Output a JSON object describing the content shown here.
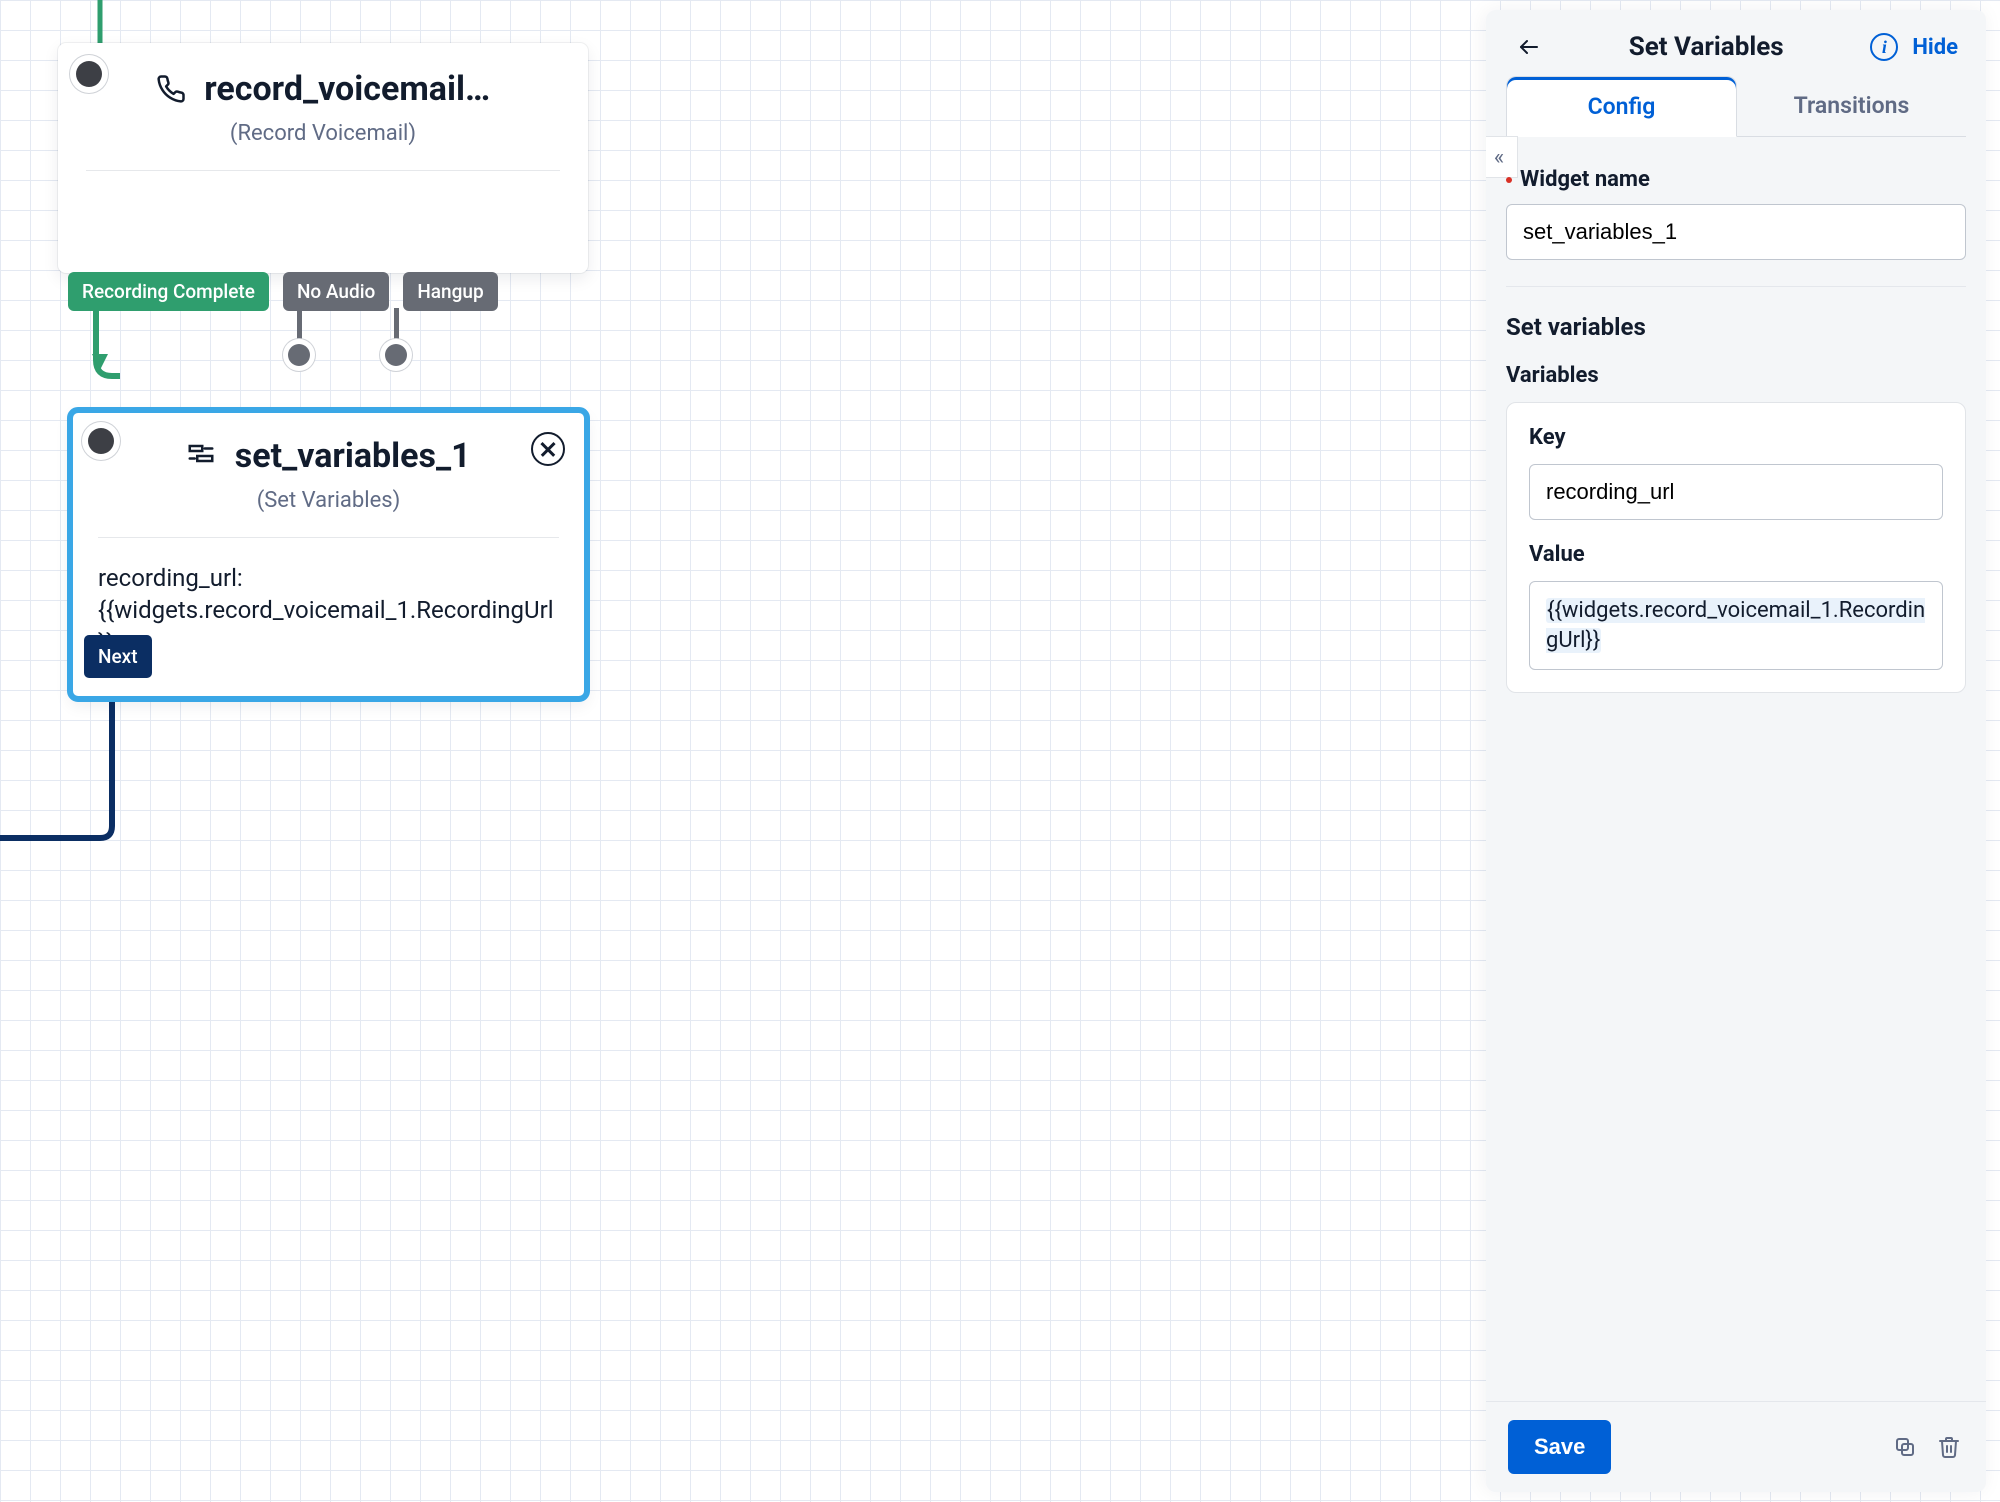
{
  "node1": {
    "title": "record_voicemail…",
    "subtitle": "(Record Voicemail)",
    "transitions": {
      "recording_complete": "Recording Complete",
      "no_audio": "No Audio",
      "hangup": "Hangup"
    }
  },
  "node2": {
    "title": "set_variables_1",
    "subtitle": "(Set Variables)",
    "body": "recording_url: {{widgets.record_voicemail_1.RecordingUrl}}",
    "next_label": "Next"
  },
  "panel": {
    "title": "Set Variables",
    "hide": "Hide",
    "tabs": {
      "config": "Config",
      "transitions": "Transitions"
    },
    "widget_name_label": "Widget name",
    "widget_name_value": "set_variables_1",
    "section_title": "Set variables",
    "variables_title": "Variables",
    "key_label": "Key",
    "key_value": "recording_url",
    "value_label": "Value",
    "value_value": "{{widgets.record_voicemail_1.RecordingUrl}}",
    "save": "Save"
  }
}
